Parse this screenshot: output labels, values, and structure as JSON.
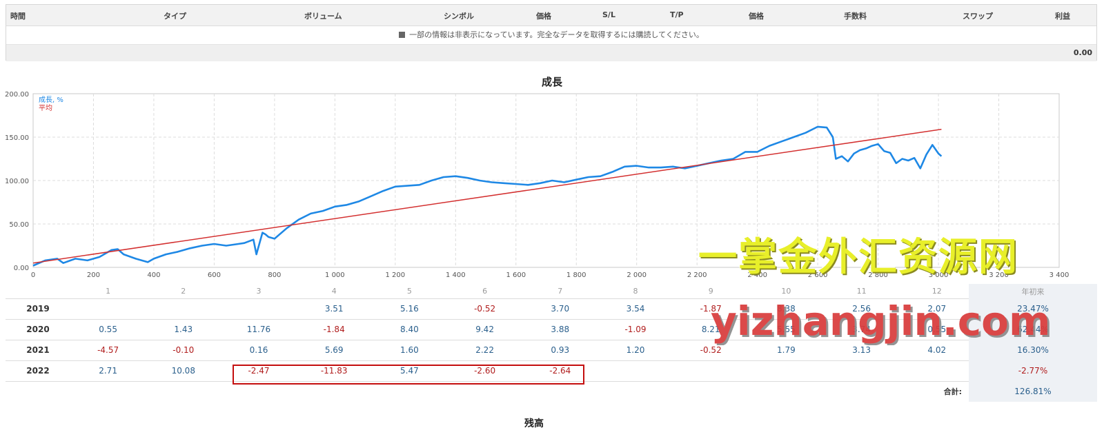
{
  "history": {
    "columns": [
      "時間",
      "タイプ",
      "ボリューム",
      "シンボル",
      "価格",
      "S/L",
      "T/P",
      "価格",
      "手数料",
      "スワップ",
      "利益"
    ],
    "notice": "一部の情報は非表示になっています。完全なデータを取得するには購読してください。",
    "total": "0.00"
  },
  "chart_title": "成長",
  "chart_data": {
    "type": "line",
    "legend": [
      "成長, %",
      "平均"
    ],
    "legend_placement": "top-left",
    "colors": {
      "growth": "#1e88e5",
      "average": "#d32f2f"
    },
    "xlim": [
      0,
      3400
    ],
    "ylim": [
      0,
      200
    ],
    "x_ticks": [
      "0",
      "200",
      "400",
      "600",
      "800",
      "1 000",
      "1 200",
      "1 400",
      "1 600",
      "1 800",
      "2 000",
      "2 200",
      "2 400",
      "2 600",
      "2 800",
      "3 000",
      "3 200",
      "3 400"
    ],
    "y_ticks": [
      "0.00",
      "50.00",
      "100.00",
      "150.00",
      "200.00"
    ],
    "grid": true,
    "series": [
      {
        "name": "成長, %",
        "x": [
          0,
          40,
          80,
          100,
          140,
          180,
          220,
          260,
          280,
          300,
          340,
          380,
          400,
          440,
          480,
          520,
          560,
          600,
          640,
          680,
          700,
          730,
          740,
          760,
          770,
          780,
          800,
          840,
          880,
          920,
          960,
          1000,
          1040,
          1080,
          1120,
          1160,
          1200,
          1240,
          1280,
          1320,
          1360,
          1400,
          1440,
          1480,
          1520,
          1560,
          1600,
          1640,
          1680,
          1720,
          1760,
          1800,
          1840,
          1880,
          1920,
          1960,
          2000,
          2040,
          2080,
          2120,
          2160,
          2200,
          2240,
          2280,
          2320,
          2360,
          2400,
          2440,
          2480,
          2520,
          2560,
          2600,
          2630,
          2650,
          2660,
          2680,
          2700,
          2720,
          2740,
          2760,
          2780,
          2800,
          2820,
          2840,
          2860,
          2880,
          2900,
          2920,
          2940,
          2960,
          2980,
          3000,
          3010
        ],
        "values": [
          2,
          8,
          10,
          5,
          10,
          8,
          12,
          20,
          21,
          15,
          10,
          6,
          10,
          15,
          18,
          22,
          25,
          27,
          25,
          27,
          28,
          32,
          15,
          40,
          38,
          35,
          33,
          45,
          55,
          62,
          65,
          70,
          72,
          76,
          82,
          88,
          93,
          94,
          95,
          100,
          104,
          105,
          103,
          100,
          98,
          97,
          96,
          95,
          97,
          100,
          98,
          101,
          104,
          105,
          110,
          116,
          117,
          115,
          115,
          116,
          114,
          117,
          120,
          123,
          125,
          133,
          133,
          140,
          145,
          150,
          155,
          162,
          161,
          150,
          125,
          128,
          122,
          131,
          135,
          137,
          140,
          142,
          134,
          132,
          120,
          125,
          123,
          126,
          114,
          130,
          141,
          131,
          128
        ]
      },
      {
        "name": "平均",
        "x": [
          0,
          3010
        ],
        "values": [
          5,
          159
        ]
      }
    ]
  },
  "monthly": {
    "months": [
      "1",
      "2",
      "3",
      "4",
      "5",
      "6",
      "7",
      "8",
      "9",
      "10",
      "11",
      "12"
    ],
    "ytd_label": "年初来",
    "rows": [
      {
        "year": "2019",
        "values": [
          "",
          "",
          "",
          "3.51",
          "5.16",
          "-0.52",
          "3.70",
          "3.54",
          "-1.87",
          "8.38",
          "2.56",
          "2.07"
        ],
        "ytd": "23.47%"
      },
      {
        "year": "2020",
        "values": [
          "0.55",
          "1.43",
          "11.76",
          "-1.84",
          "8.40",
          "9.42",
          "3.88",
          "-1.09",
          "8.21",
          "5.55",
          "3.74",
          "0.55"
        ],
        "ytd": "62.44%"
      },
      {
        "year": "2021",
        "values": [
          "-4.57",
          "-0.10",
          "0.16",
          "5.69",
          "1.60",
          "2.22",
          "0.93",
          "1.20",
          "-0.52",
          "1.79",
          "3.13",
          "4.02"
        ],
        "ytd": "16.30%"
      },
      {
        "year": "2022",
        "values": [
          "2.71",
          "10.08",
          "-2.47",
          "-11.83",
          "5.47",
          "-2.60",
          "-2.64",
          "",
          "",
          "",
          "",
          ""
        ],
        "ytd": "-2.77%"
      }
    ],
    "total_label": "合計:",
    "total_value": "126.81%"
  },
  "watermark": {
    "line1": "一掌金外汇资源网",
    "line2": "yizhangjin.com"
  },
  "next_section_title": "残高"
}
